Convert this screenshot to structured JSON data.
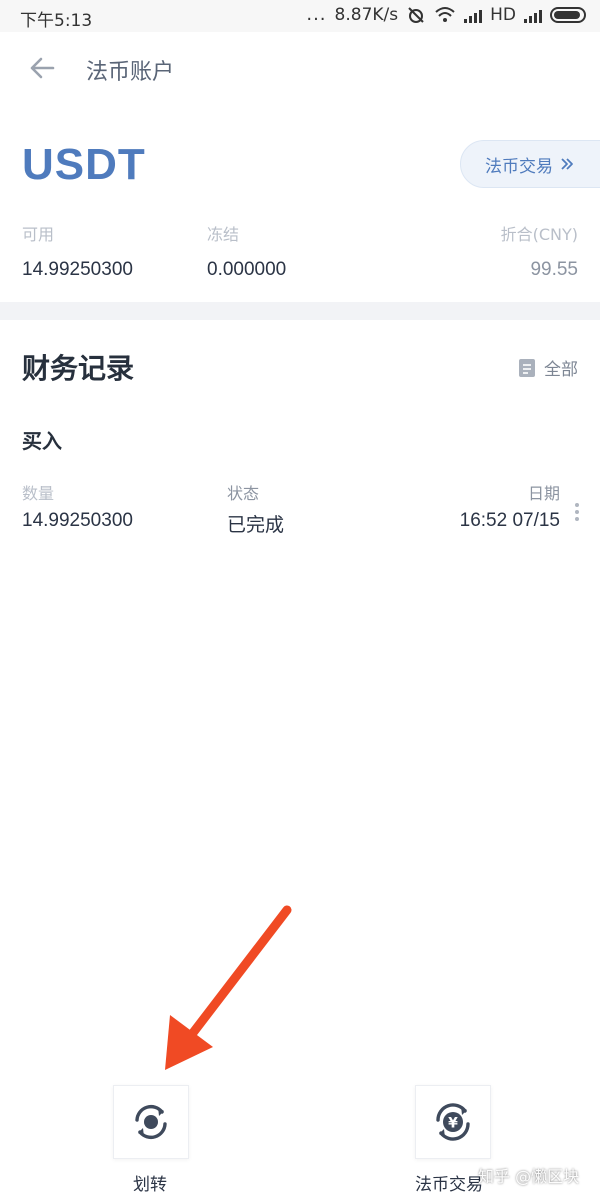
{
  "status_bar": {
    "time": "下午5:13",
    "dots": "...",
    "speed": "8.87K/s",
    "network": "HD"
  },
  "nav": {
    "title": "法币账户"
  },
  "account": {
    "currency": "USDT",
    "fiat_trade_button": "法币交易",
    "available_label": "可用",
    "available_value": "14.99250300",
    "frozen_label": "冻结",
    "frozen_value": "0.000000",
    "cny_label": "折合(CNY)",
    "cny_value": "99.55"
  },
  "records": {
    "title": "财务记录",
    "all_label": "全部",
    "items": [
      {
        "type": "买入",
        "qty_label": "数量",
        "qty_value": "14.99250300",
        "status_label": "状态",
        "status_value": "已完成",
        "date_label": "日期",
        "date_value": "16:52 07/15"
      }
    ]
  },
  "actions": {
    "transfer_label": "划转",
    "fiat_trade_label": "法币交易"
  },
  "watermark": "知乎 @懒区块",
  "colors": {
    "accent": "#4f7bbd",
    "annotation_arrow": "#f04a24"
  }
}
